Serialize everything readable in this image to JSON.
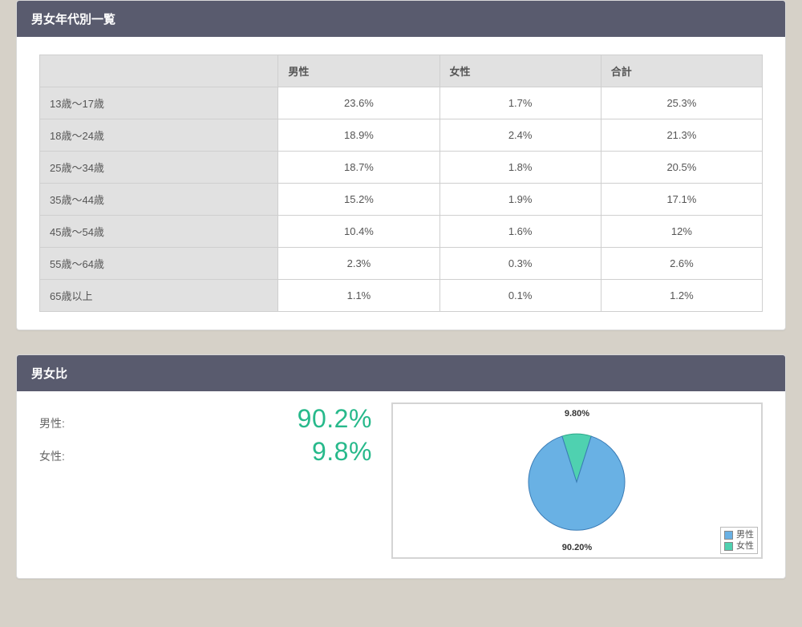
{
  "panelTable": {
    "title": "男女年代別一覧",
    "columns": [
      "男性",
      "女性",
      "合計"
    ],
    "rows": [
      {
        "label": "13歳～17歳",
        "male": "23.6%",
        "female": "1.7%",
        "total": "25.3%"
      },
      {
        "label": "18歳～24歳",
        "male": "18.9%",
        "female": "2.4%",
        "total": "21.3%"
      },
      {
        "label": "25歳～34歳",
        "male": "18.7%",
        "female": "1.8%",
        "total": "20.5%"
      },
      {
        "label": "35歳～44歳",
        "male": "15.2%",
        "female": "1.9%",
        "total": "17.1%"
      },
      {
        "label": "45歳～54歳",
        "male": "10.4%",
        "female": "1.6%",
        "total": "12%"
      },
      {
        "label": "55歳～64歳",
        "male": "2.3%",
        "female": "0.3%",
        "total": "2.6%"
      },
      {
        "label": "65歳以上",
        "male": "1.1%",
        "female": "0.1%",
        "total": "1.2%"
      }
    ]
  },
  "panelRatio": {
    "title": "男女比",
    "maleLabel": "男性:",
    "femaleLabel": "女性:",
    "maleValue": "90.2%",
    "femaleValue": "9.8%",
    "legendMale": "男性",
    "legendFemale": "女性",
    "pieMaleLabel": "90.20%",
    "pieFemaleLabel": "9.80%"
  },
  "colors": {
    "male": "#69b1e4",
    "female": "#4fd1b0",
    "maleBorder": "#3a7bb5",
    "femaleBorder": "#2ba889"
  },
  "chart_data": {
    "type": "pie",
    "title": "男女比",
    "series": [
      {
        "name": "男性",
        "value": 90.2,
        "color": "#69b1e4"
      },
      {
        "name": "女性",
        "value": 9.8,
        "color": "#4fd1b0"
      }
    ],
    "data_labels": [
      "90.20%",
      "9.80%"
    ],
    "legend_position": "bottom-right"
  }
}
